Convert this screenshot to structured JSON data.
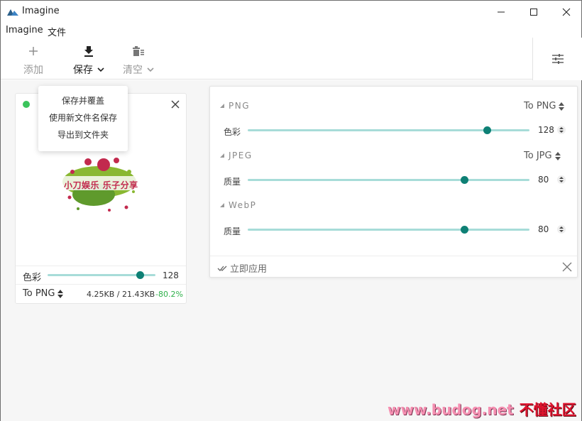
{
  "window": {
    "title": "Imagine"
  },
  "menu": {
    "items": [
      "Imagine",
      "文件"
    ]
  },
  "toolbar": {
    "add_label": "添加",
    "save_label": "保存",
    "clear_label": "清空"
  },
  "save_menu": {
    "items": [
      "保存并覆盖",
      "使用新文件名保存",
      "导出到文件夹"
    ]
  },
  "card": {
    "preview_text": "小刀娱乐 乐子分享",
    "color_label": "色彩",
    "color_value": "128",
    "color_level": 0.86,
    "format_label": "To PNG",
    "size_text": "4.25KB / 21.43KB",
    "ratio_text": "-80.2%",
    "status_color": "#3bc45c"
  },
  "panel": {
    "png": {
      "title": "PNG",
      "to": "To PNG",
      "row_label": "色彩",
      "value": "128",
      "level": 0.85
    },
    "jpeg": {
      "title": "JPEG",
      "to": "To JPG",
      "row_label": "质量",
      "value": "80",
      "level": 0.77
    },
    "webp": {
      "title": "WebP",
      "row_label": "质量",
      "value": "80",
      "level": 0.77
    },
    "apply_label": "立即应用"
  },
  "watermark": {
    "site": "www.budog.net",
    "brand": "不懂社区"
  },
  "colors": {
    "accent": "#0e8075",
    "track": "#a7dcd8",
    "ok": "#2eb04a"
  }
}
